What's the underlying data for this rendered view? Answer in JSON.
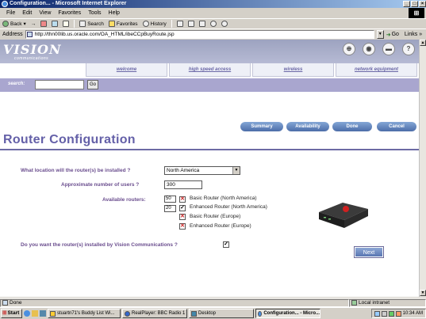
{
  "window": {
    "title": "Configuration... - Microsoft Internet Explorer"
  },
  "menu": [
    "File",
    "Edit",
    "View",
    "Favorites",
    "Tools",
    "Help"
  ],
  "toolbar": {
    "back": "Back",
    "search": "Search",
    "favorites": "Favorites",
    "history": "History"
  },
  "address": {
    "label": "Address",
    "url": "http://thn00lib.us.oracle.com/OA_HTML/ibeCCpBuyRoute.jsp",
    "go": "Go",
    "links": "Links"
  },
  "site": {
    "logo": "VISION",
    "logo_sub": "communications",
    "nav": [
      "welcome",
      "high speed access",
      "wireless",
      "network equipment"
    ],
    "search_label": "search:",
    "search_go": "Go"
  },
  "actions": {
    "summary": "Summary",
    "availability": "Availability",
    "done": "Done",
    "cancel": "Cancel"
  },
  "page": {
    "title": "Router Configuration",
    "q_location": "What location will the router(s) be installed ?",
    "location_value": "North America",
    "q_users": "Approximate number of users ?",
    "users_value": "300",
    "available_label": "Available routers:",
    "routers": [
      {
        "qty": "50",
        "checked": "✕",
        "name": "Basic Router (North America)"
      },
      {
        "qty": "20",
        "checked": "✓",
        "name": "Enhanced Router (North America)"
      },
      {
        "qty": "",
        "checked": "✕",
        "name": "Basic Router (Europe)"
      },
      {
        "qty": "",
        "checked": "✕",
        "name": "Enhanced Router (Europe)"
      }
    ],
    "q_install": "Do you want the router(s) installed by Vision Communications ?",
    "install_checked": "✓",
    "next": "Next"
  },
  "status": {
    "left": "Done",
    "zone": "Local intranet"
  },
  "taskbar": {
    "start": "Start",
    "tasks": [
      "stuartn71's Buddy List Wi...",
      "RealPlayer: BBC Radio 1",
      "Desktop",
      "Configuration... - Micro..."
    ],
    "clock": "10:34 AM"
  }
}
